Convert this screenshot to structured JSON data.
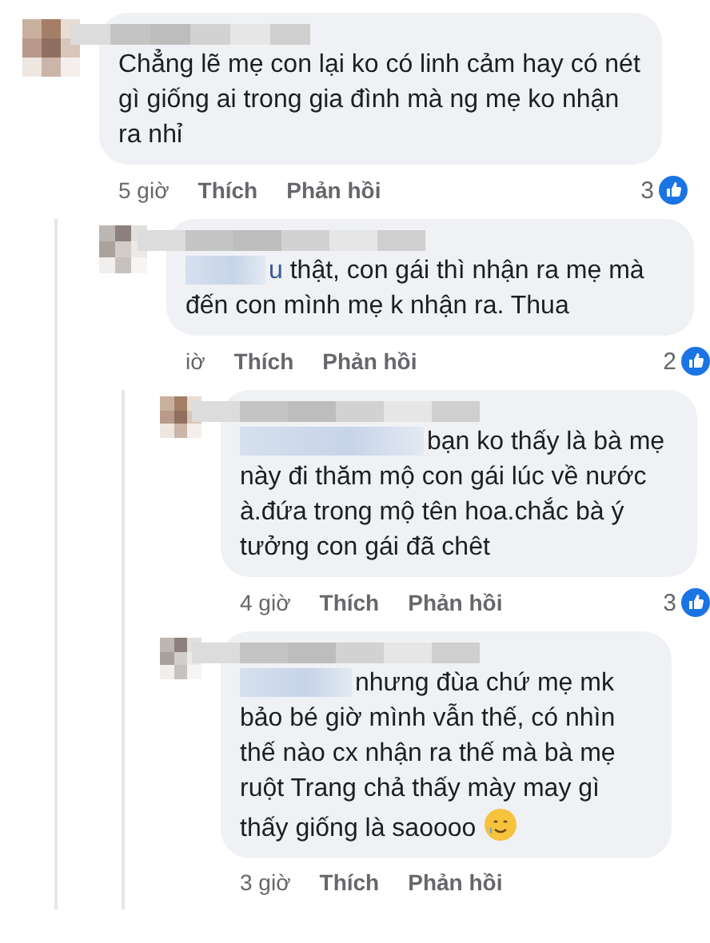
{
  "comments": [
    {
      "text": "Chẳng lẽ mẹ con lại ko có linh cảm hay có nét gì giống ai trong gia đình mà ng mẹ ko nhận ra nhỉ",
      "time": "5 giờ",
      "like": "Thích",
      "reply": "Phản hồi",
      "reactions": "3",
      "children": [
        {
          "mention": "u",
          "text": " thật, con gái thì nhận ra mẹ mà đến con mình mẹ k nhận ra. Thua",
          "time": "iờ",
          "like": "Thích",
          "reply": "Phản hồi",
          "reactions": "2",
          "children": [
            {
              "kind": "plain",
              "text": "bạn ko thấy là bà mẹ này đi thăm mộ con gái lúc về nước à.đứa trong mộ tên hoa.chắc bà ý tưởng con gái đã chêt",
              "time": "4 giờ",
              "like": "Thích",
              "reply": "Phản hồi",
              "reactions": "3"
            },
            {
              "kind": "emoji_end",
              "text": "nhưng đùa chứ mẹ mk bảo bé giờ mình vẫn thế, có nhìn thế nào cx nhận ra thế mà bà mẹ ruột Trang chả thấy mày may gì thấy giống là saoooo",
              "time": "3 giờ",
              "like": "Thích",
              "reply": "Phản hồi"
            }
          ]
        }
      ]
    }
  ]
}
